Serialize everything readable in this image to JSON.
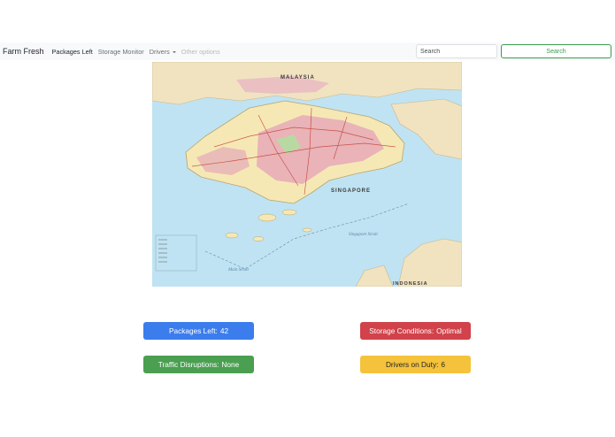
{
  "navbar": {
    "brand": "Farm Fresh",
    "links": [
      {
        "label": "Packages Left"
      },
      {
        "label": "Storage Monitor"
      },
      {
        "label": "Drivers"
      },
      {
        "label": "Other options"
      }
    ]
  },
  "search": {
    "placeholder": "Search",
    "button_label": "Search"
  },
  "map": {
    "labels": {
      "country_north": "MALAYSIA",
      "country_main": "SINGAPORE",
      "country_south": "INDONESIA",
      "strait_singapore": "Singapore Strait",
      "strait_main": "Main Strait"
    }
  },
  "stats": [
    {
      "label": "Packages Left:",
      "value": "42",
      "color": "#3b7ded"
    },
    {
      "label": "Storage Conditions:",
      "value": "Optimal",
      "color": "#d1424a"
    },
    {
      "label": "Traffic Disruptions:",
      "value": "None",
      "color": "#4a9f51"
    },
    {
      "label": "Drivers on Duty:",
      "value": "6",
      "color": "#f5c23c"
    }
  ]
}
